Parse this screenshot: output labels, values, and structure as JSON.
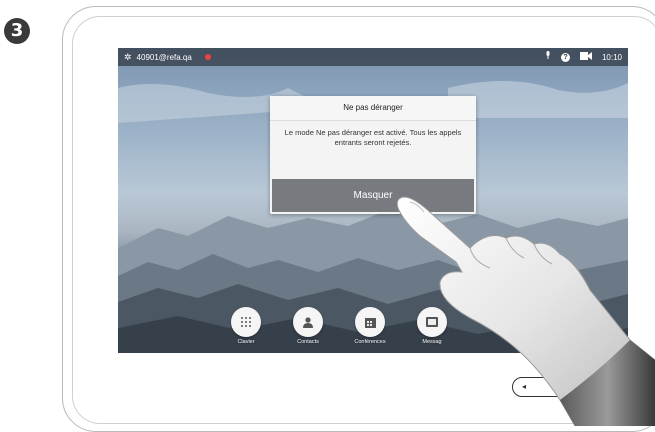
{
  "step": {
    "number": "3"
  },
  "statusbar": {
    "address": "40901@refa.qa",
    "time": "10:10",
    "icons": [
      "gear-icon",
      "presence-red-dot-icon",
      "microphone-status-icon",
      "help-icon",
      "selfview-camera-icon"
    ]
  },
  "dialog": {
    "title": "Ne pas déranger",
    "message": "Le mode Ne pas déranger est activé. Tous les appels entrants seront rejetés.",
    "button_label": "Masquer"
  },
  "dock": {
    "items": [
      {
        "label": "Clavier",
        "icon": "keypad-icon"
      },
      {
        "label": "Contacts",
        "icon": "contacts-icon"
      },
      {
        "label": "Conférences",
        "icon": "calendar-icon"
      },
      {
        "label": "Messag",
        "icon": "messages-icon"
      }
    ]
  },
  "hardware": {
    "volume_minus": "◂",
    "volume_plus": "◂",
    "icons": [
      "volume-down-icon",
      "volume-up-icon",
      "mute-microphone-icon"
    ]
  },
  "colors": {
    "dialog_button": "#777b80",
    "statusbar_bg": "#14181e",
    "presence_red": "#e8453c",
    "step_badge": "#3a3a3a"
  }
}
